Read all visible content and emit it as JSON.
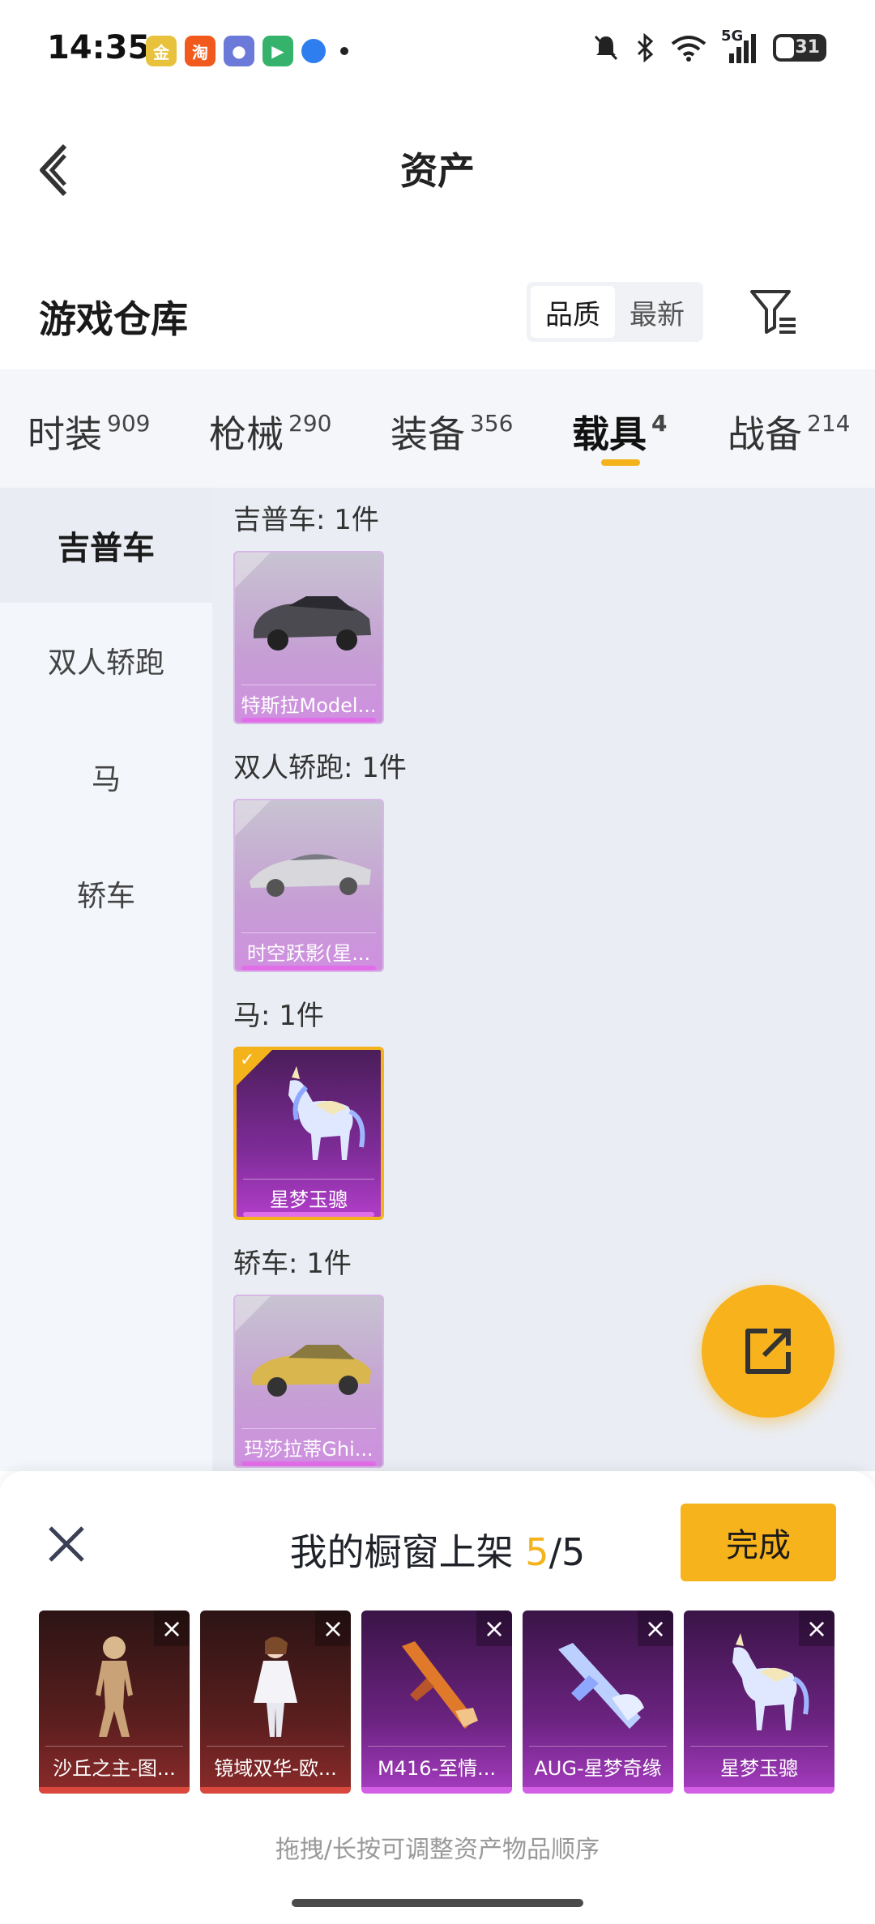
{
  "status_bar": {
    "time": "14:35",
    "battery": "31",
    "network": "5G"
  },
  "header": {
    "title": "资产"
  },
  "warehouse": {
    "title": "游戏仓库",
    "sort_options": [
      "品质",
      "最新"
    ],
    "sort_selected": "品质"
  },
  "tabs": [
    {
      "label": "时装",
      "count": "909"
    },
    {
      "label": "枪械",
      "count": "290"
    },
    {
      "label": "装备",
      "count": "356"
    },
    {
      "label": "载具",
      "count": "4"
    },
    {
      "label": "战备",
      "count": "214"
    }
  ],
  "active_tab": "载具",
  "sidebar": {
    "items": [
      "吉普车",
      "双人轿跑",
      "马",
      "轿车"
    ],
    "active": "吉普车"
  },
  "sections": [
    {
      "header": "吉普车: 1件",
      "items": [
        {
          "name": "特斯拉Model...",
          "selected": false
        }
      ]
    },
    {
      "header": "双人轿跑: 1件",
      "items": [
        {
          "name": "时空跃影(星...",
          "selected": false
        }
      ]
    },
    {
      "header": "马: 1件",
      "items": [
        {
          "name": "星梦玉骢",
          "selected": true
        }
      ]
    },
    {
      "header": "轿车: 1件",
      "items": [
        {
          "name": "玛莎拉蒂Ghi...",
          "selected": false
        }
      ]
    }
  ],
  "showcase": {
    "title_prefix": "我的橱窗上架 ",
    "count": "5",
    "total": "/5",
    "done_label": "完成",
    "slots": [
      {
        "name": "沙丘之主-图...",
        "quality": "red"
      },
      {
        "name": "镜域双华-欧...",
        "quality": "red"
      },
      {
        "name": "M416-至情...",
        "quality": "purple"
      },
      {
        "name": "AUG-星梦奇缘",
        "quality": "purple"
      },
      {
        "name": "星梦玉骢",
        "quality": "purple"
      }
    ],
    "hint": "拖拽/长按可调整资产物品顺序"
  },
  "colors": {
    "accent": "#f7b31c",
    "purple_quality": "#a63cc0",
    "red_quality": "#8d2b2b"
  }
}
